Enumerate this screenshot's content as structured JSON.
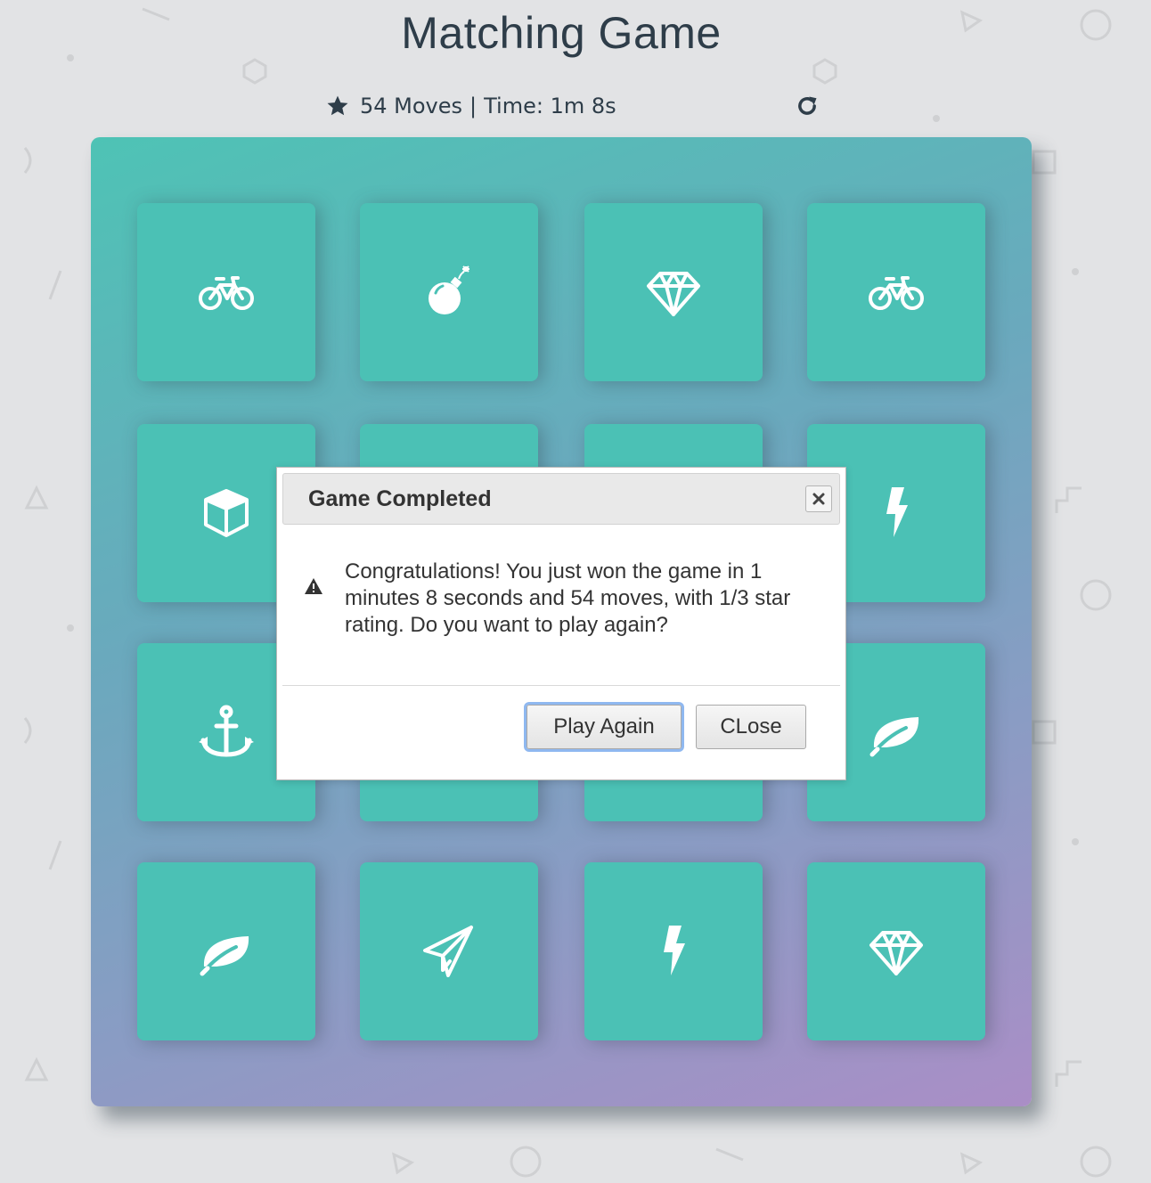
{
  "title": "Matching Game",
  "score_panel": {
    "star_icon": "star-icon",
    "moves": "54 Moves",
    "separator": "|",
    "time": "Time: 1m 8s",
    "restart_icon": "restart-icon"
  },
  "deck": {
    "cards": [
      {
        "icon": "bicycle-icon"
      },
      {
        "icon": "bomb-icon"
      },
      {
        "icon": "diamond-icon"
      },
      {
        "icon": "bicycle-icon"
      },
      {
        "icon": "cube-icon"
      },
      {
        "icon": "hidden"
      },
      {
        "icon": "hidden"
      },
      {
        "icon": "bolt-icon"
      },
      {
        "icon": "anchor-icon"
      },
      {
        "icon": "hidden"
      },
      {
        "icon": "hidden"
      },
      {
        "icon": "leaf-icon"
      },
      {
        "icon": "leaf-icon"
      },
      {
        "icon": "paper-plane-icon"
      },
      {
        "icon": "bolt-icon"
      },
      {
        "icon": "diamond-icon"
      }
    ]
  },
  "modal": {
    "title": "Game Completed",
    "message": "Congratulations! You just won the game in 1 minutes 8 seconds and 54 moves, with 1/3 star rating. Do you want to play again?",
    "play_again_label": "Play Again",
    "close_label": "CLose"
  },
  "colors": {
    "card": "#4bc1b5",
    "deck_start": "#4ec3b5",
    "deck_end": "#aa8ec6",
    "background": "#e2e3e5"
  }
}
